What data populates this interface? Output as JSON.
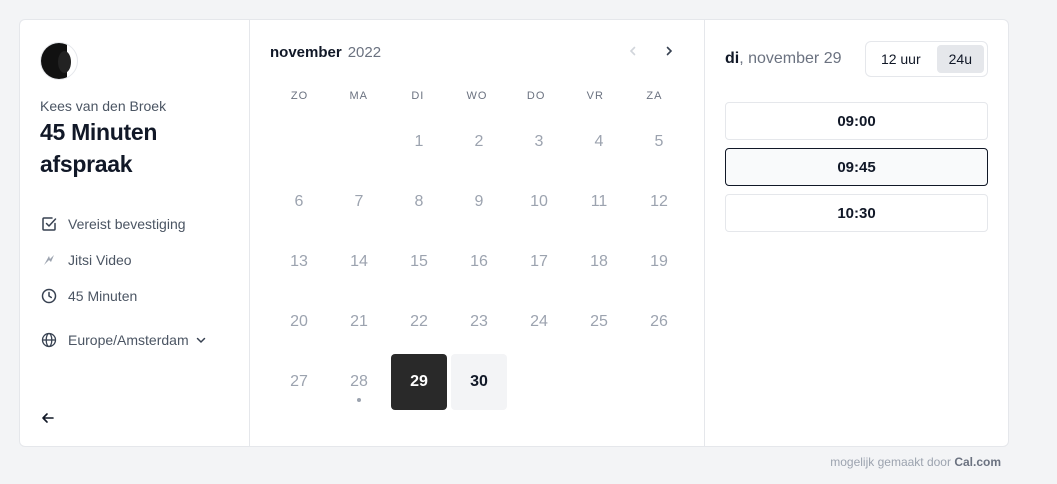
{
  "profile": {
    "owner": "Kees van den Broek",
    "event_title": "45 Minuten afspraak",
    "meta": [
      {
        "icon": "checkbox-icon",
        "label": "Vereist bevestiging"
      },
      {
        "icon": "jitsi-icon",
        "label": "Jitsi Video"
      },
      {
        "icon": "clock-icon",
        "label": "45 Minuten"
      }
    ],
    "timezone": "Europe/Amsterdam"
  },
  "calendar": {
    "month": "november",
    "year": "2022",
    "weekdays": [
      "ZO",
      "MA",
      "DI",
      "WO",
      "DO",
      "VR",
      "ZA"
    ],
    "leading_blanks": 2,
    "days": [
      "1",
      "2",
      "3",
      "4",
      "5",
      "6",
      "7",
      "8",
      "9",
      "10",
      "11",
      "12",
      "13",
      "14",
      "15",
      "16",
      "17",
      "18",
      "19",
      "20",
      "21",
      "22",
      "23",
      "24",
      "25",
      "26",
      "27",
      "28",
      "29",
      "30"
    ],
    "selected_day": "29",
    "available_days": [
      "30"
    ],
    "today_dot_day": "28"
  },
  "slots_panel": {
    "weekday": "di",
    "date": ", november 29",
    "format_12": "12 uur",
    "format_24": "24u",
    "active_format": "24u",
    "times": [
      "09:00",
      "09:45",
      "10:30"
    ],
    "hovered_time": "09:45"
  },
  "footer": {
    "text": "mogelijk gemaakt door ",
    "brand": "Cal.com"
  }
}
